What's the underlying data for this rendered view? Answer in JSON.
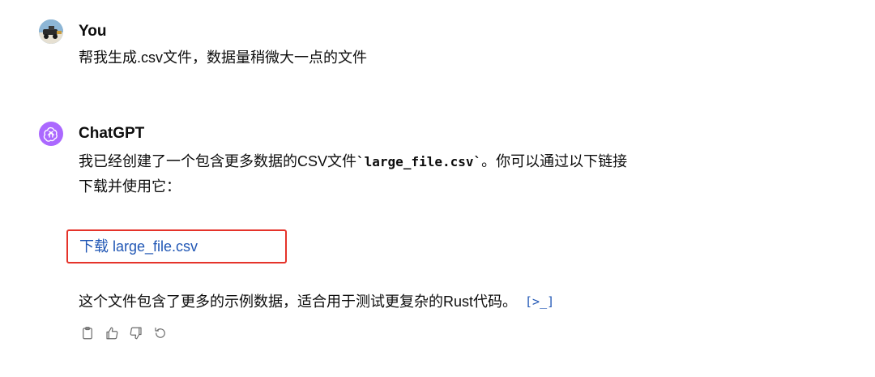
{
  "conversation": {
    "user_message": {
      "author": "You",
      "text": "帮我生成.csv文件，数据量稍微大一点的文件"
    },
    "assistant_message": {
      "author": "ChatGPT",
      "line1_pre": "我已经创建了一个包含更多数据的CSV文件",
      "inline_code": "`large_file.csv`",
      "line1_post": "。你可以通过以下链接",
      "line2": "下载并使用它：",
      "download_link": "下载 large_file.csv",
      "line3": "这个文件包含了更多的示例数据，适合用于测试更复杂的Rust代码。",
      "code_interpreter_marker": "[>_]"
    },
    "actions": [
      {
        "icon": "clipboard-icon"
      },
      {
        "icon": "thumbs-up-icon"
      },
      {
        "icon": "thumbs-down-icon"
      },
      {
        "icon": "regenerate-icon"
      }
    ]
  },
  "colors": {
    "link": "#2157b5",
    "highlight_box": "#e5332a",
    "chatgpt_avatar": "#ab68ff"
  }
}
